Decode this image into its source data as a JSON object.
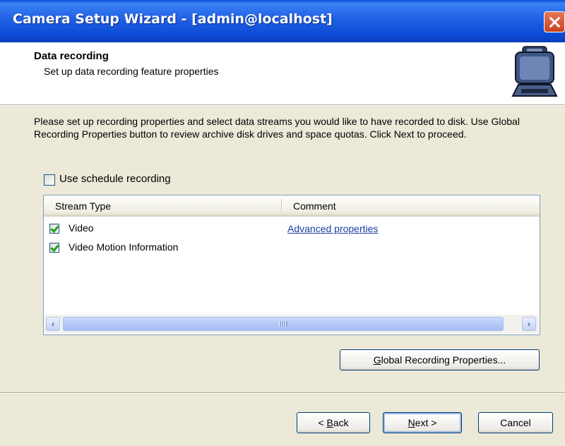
{
  "window": {
    "title": "Camera Setup Wizard - [admin@localhost]"
  },
  "header": {
    "title": "Data recording",
    "subtitle": "Set up data recording feature properties",
    "icon": "camera-case-icon"
  },
  "instructions": "Please set up recording properties and select data streams you would like to have recorded to disk. Use Global Recording Properties button to review archive disk drives and space quotas. Click Next to proceed.",
  "schedule": {
    "label": "Use schedule recording",
    "checked": false
  },
  "streams": {
    "columns": [
      "Stream Type",
      "Comment"
    ],
    "rows": [
      {
        "name": "Video",
        "checked": true,
        "comment": "Advanced properties"
      },
      {
        "name": "Video Motion Information",
        "checked": true,
        "comment": ""
      }
    ]
  },
  "buttons": {
    "global_first": "G",
    "global_rest": "lobal Recording Properties...",
    "back_prefix": "< ",
    "back_first": "B",
    "back_rest": "ack",
    "next_first": "N",
    "next_rest": "ext >",
    "cancel": "Cancel"
  },
  "colors": {
    "titlebar": "#2464e6",
    "dialog": "#ece9d8",
    "link": "#1a3ea6",
    "check": "#21a121"
  }
}
